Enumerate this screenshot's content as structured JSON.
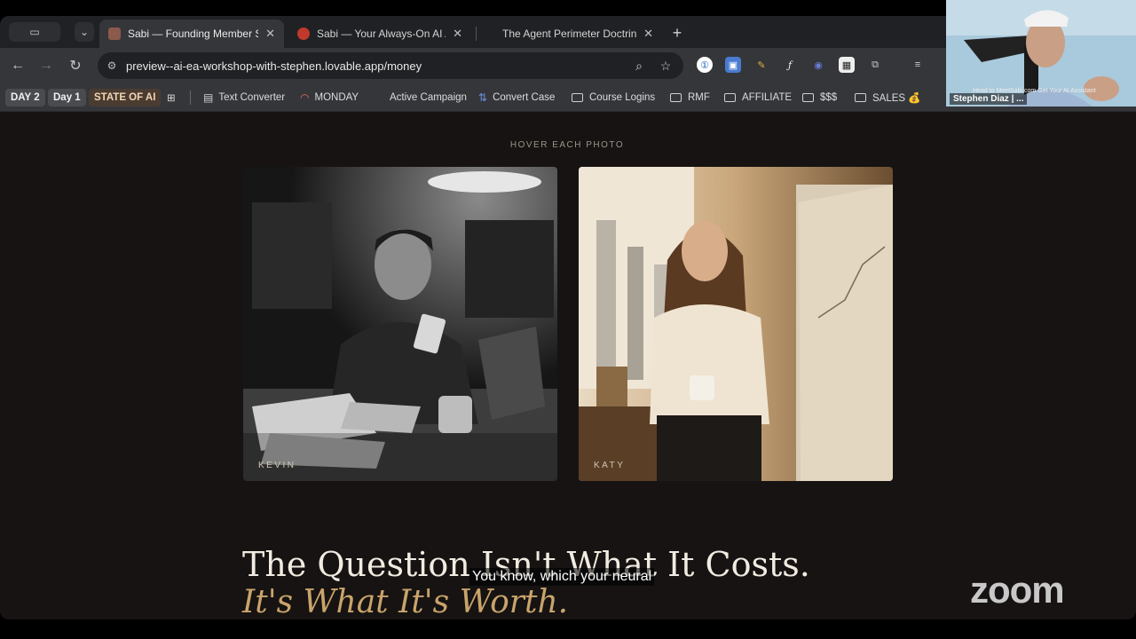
{
  "browser": {
    "tabs": [
      {
        "title": "Sabi — Founding Member Se",
        "active": true,
        "favicon_color": "#8b5a4a"
      },
      {
        "title": "Sabi — Your Always-On AI As",
        "active": false,
        "favicon_color": "#c0392b"
      },
      {
        "title": "The Agent Perimeter Doctrine",
        "active": false,
        "favicon_color": ""
      }
    ],
    "url": "preview--ai-ea-workshop-with-stephen.lovable.app/money",
    "bookmarks": {
      "chips": [
        "DAY 2",
        "Day 1"
      ],
      "state_of_ai": "STATE OF AI",
      "items": [
        "Text Converter",
        "MONDAY",
        "Active Campaign",
        "Convert Case",
        "Course Logins",
        "RMF",
        "AFFILIATE",
        "$$$",
        "SALES 💰"
      ]
    },
    "accent_color": "#c9a46b"
  },
  "page": {
    "hover_label": "HOVER EACH PHOTO",
    "photos": [
      {
        "name": "KEVIN"
      },
      {
        "name": "KATY"
      }
    ],
    "heading": "The Question Isn't What It Costs.",
    "subheading": "It's What It's Worth."
  },
  "overlay": {
    "caption": "You know, which your neural",
    "zoom_logo": "zoom",
    "webcam_name": "Stephen Diaz | ...",
    "webcam_ticker": "Head to MeetSabi.com Get Your AI Assistant"
  }
}
